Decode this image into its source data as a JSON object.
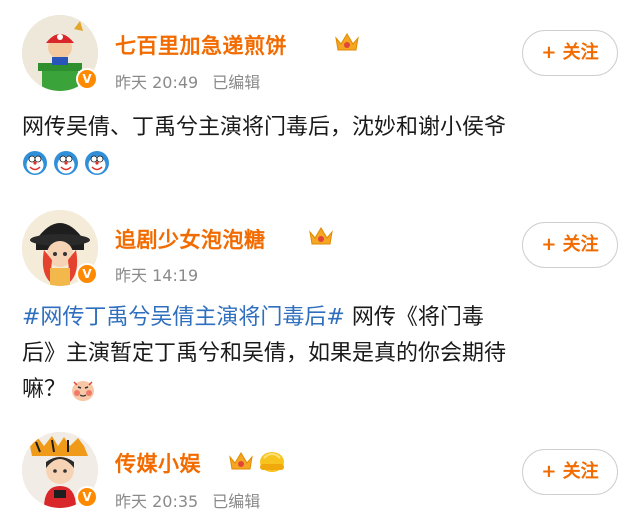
{
  "posts": [
    {
      "username": "七百里加急递煎饼",
      "time": "昨天 20:49",
      "edited": "已编辑",
      "follow_label": "+ 关注",
      "text": "网传吴倩、丁禹兮主演将门毒后，沈妙和谢小侯爷",
      "emoji_icons": [
        "doraemon-emoji",
        "doraemon-emoji",
        "doraemon-emoji"
      ]
    },
    {
      "username": "追剧少女泡泡糖",
      "time": "昨天 14:19",
      "follow_label": "+ 关注",
      "hashtag": "#网传丁禹兮吴倩主演将门毒后#",
      "text_line1": " 网传《将门毒",
      "text_line2": "后》主演暂定丁禹兮和吴倩，如果是真的你会期待",
      "text_line3": "嘛？",
      "emoji_icons": [
        "shy-face-emoji"
      ]
    },
    {
      "username": "传媒小娱",
      "time": "昨天 20:35",
      "edited": "已编辑",
      "follow_label": "+ 关注"
    }
  ],
  "colors": {
    "username": "#f26b00",
    "hashtag": "#2f6fbd",
    "meta": "#8a8a8a",
    "verified_badge": "#ff8a00"
  }
}
